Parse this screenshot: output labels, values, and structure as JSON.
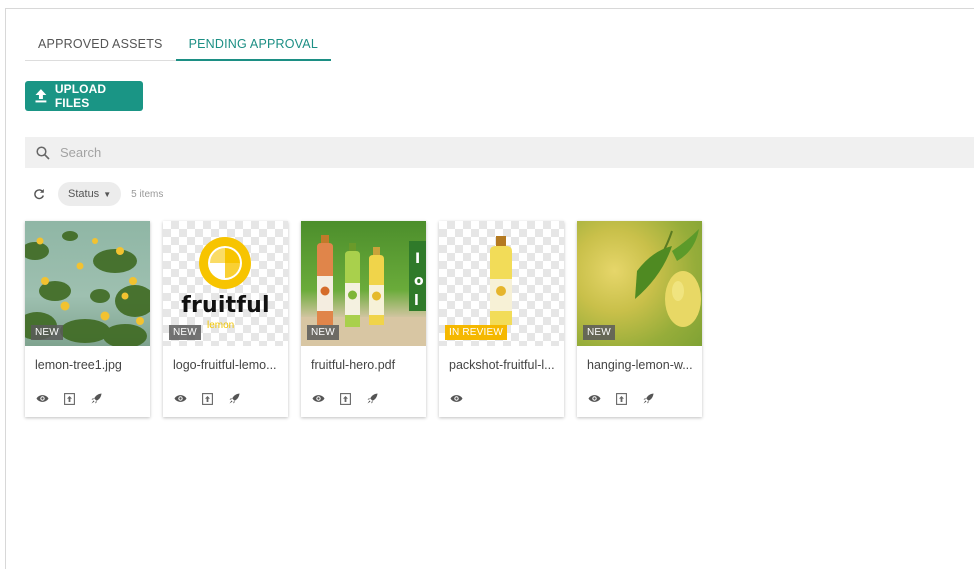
{
  "tabs": [
    {
      "label": "APPROVED ASSETS",
      "active": false
    },
    {
      "label": "PENDING APPROVAL",
      "active": true
    }
  ],
  "upload": {
    "label": "UPLOAD FILES",
    "icon": "upload-icon"
  },
  "search": {
    "placeholder": "Search",
    "value": "",
    "icon": "search-icon"
  },
  "filters": {
    "status_label": "Status",
    "count_text": "5 items"
  },
  "colors": {
    "accent": "#1a9585",
    "tab_active": "#1c8f84",
    "review_badge": "#f5b800"
  },
  "assets": [
    {
      "name": "lemon-tree1.jpg",
      "badge": "NEW",
      "thumbnail": "lemon tree photo",
      "actions": [
        "eye-icon",
        "upload-box-icon",
        "rocket-icon"
      ]
    },
    {
      "name": "logo-fruitful-lemo...",
      "badge": "NEW",
      "thumbnail": "fruitful lemon logo",
      "logo_text": "fruitful",
      "logo_sub": "lemon",
      "actions": [
        "eye-icon",
        "upload-box-icon",
        "rocket-icon"
      ]
    },
    {
      "name": "fruitful-hero.pdf",
      "badge": "NEW",
      "thumbnail": "three bottles on green",
      "actions": [
        "eye-icon",
        "upload-box-icon",
        "rocket-icon"
      ]
    },
    {
      "name": "packshot-fruitful-l...",
      "badge": "IN REVIEW",
      "thumbnail": "single bottle packshot",
      "actions": [
        "eye-icon"
      ]
    },
    {
      "name": "hanging-lemon-w...",
      "badge": "NEW",
      "thumbnail": "hanging lemon photo",
      "actions": [
        "eye-icon",
        "upload-box-icon",
        "rocket-icon"
      ]
    }
  ]
}
